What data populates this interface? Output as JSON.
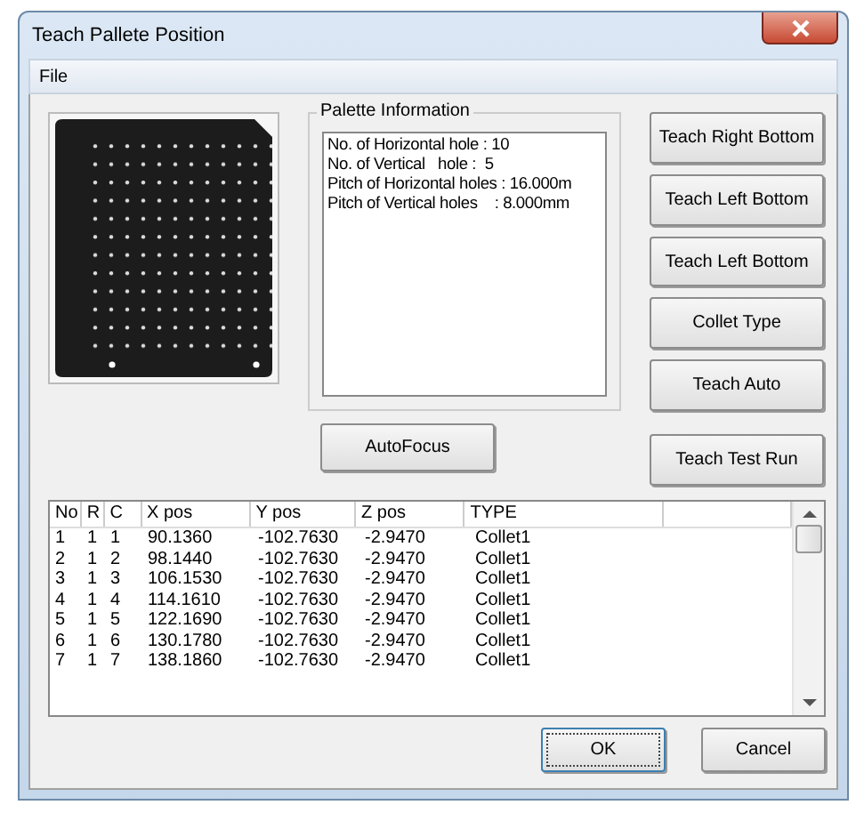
{
  "window": {
    "title": "Teach Pallete Position"
  },
  "menu": [
    "File"
  ],
  "palette_info": {
    "title": "Palette Information",
    "lines": [
      "No. of Horizontal hole : 10",
      "No. of Vertical   hole :  5",
      "Pitch of Horizontal holes : 16.000m",
      "Pitch of Vertical holes    : 8.000mm"
    ]
  },
  "side_buttons": [
    "Teach Right Bottom",
    "Teach Left Bottom",
    "Teach Left Bottom",
    "Collet Type",
    "Teach Auto",
    "Teach Test Run"
  ],
  "autofocus_button": "AutoFocus",
  "table": {
    "columns": [
      "No",
      "R",
      "C",
      "X pos",
      "Y pos",
      "Z pos",
      "TYPE"
    ],
    "rows": [
      [
        "1",
        "1",
        "1",
        "90.1360",
        "-102.7630",
        "-2.9470",
        "Collet1"
      ],
      [
        "2",
        "1",
        "2",
        "98.1440",
        "-102.7630",
        "-2.9470",
        "Collet1"
      ],
      [
        "3",
        "1",
        "3",
        "106.1530",
        "-102.7630",
        "-2.9470",
        "Collet1"
      ],
      [
        "4",
        "1",
        "4",
        "114.1610",
        "-102.7630",
        "-2.9470",
        "Collet1"
      ],
      [
        "5",
        "1",
        "5",
        "122.1690",
        "-102.7630",
        "-2.9470",
        "Collet1"
      ],
      [
        "6",
        "1",
        "6",
        "130.1780",
        "-102.7630",
        "-2.9470",
        "Collet1"
      ],
      [
        "7",
        "1",
        "7",
        "138.1860",
        "-102.7630",
        "-2.9470",
        "Collet1"
      ]
    ]
  },
  "buttons": [
    {
      "label": "OK",
      "kind": "default"
    },
    {
      "label": "Cancel",
      "kind": "normal"
    }
  ]
}
